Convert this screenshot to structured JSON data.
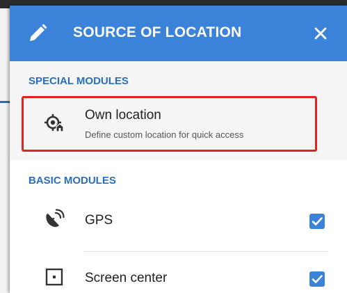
{
  "dialog": {
    "title": "SOURCE OF LOCATION",
    "header_icon": "pencil-icon",
    "close_icon": "close-icon",
    "accent_color": "#3b82d9",
    "highlight_color": "#e0231f"
  },
  "sections": [
    {
      "header": "SPECIAL MODULES",
      "items": [
        {
          "icon": "own-location-icon",
          "title": "Own location",
          "subtitle": "Define custom location for quick access",
          "highlighted": true
        }
      ]
    },
    {
      "header": "BASIC MODULES",
      "items": [
        {
          "icon": "gps-satellite-icon",
          "title": "GPS",
          "checked": true
        },
        {
          "icon": "screen-center-icon",
          "title": "Screen center",
          "checked": true
        }
      ]
    }
  ]
}
